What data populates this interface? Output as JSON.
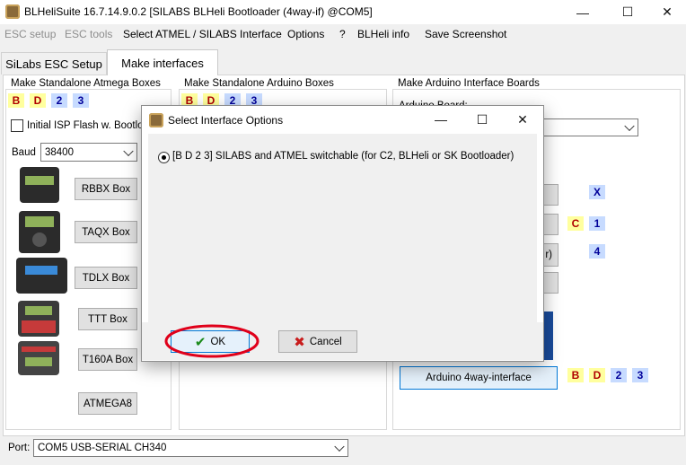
{
  "window": {
    "title": "BLHeliSuite 16.7.14.9.0.2  [SILABS BLHeli Bootloader (4way-if) @COM5]",
    "minimize": "—",
    "maximize": "☐",
    "close": "✕"
  },
  "menu": [
    {
      "label": "ESC setup",
      "enabled": false
    },
    {
      "label": "ESC tools",
      "enabled": false
    },
    {
      "label": "Select ATMEL / SILABS Interface",
      "enabled": true
    },
    {
      "label": "Options",
      "enabled": true
    },
    {
      "label": "?",
      "enabled": true
    },
    {
      "label": "BLHeli info",
      "enabled": true
    },
    {
      "label": "Save Screenshot",
      "enabled": true
    }
  ],
  "tabs": [
    {
      "label": "SiLabs ESC Setup",
      "active": false
    },
    {
      "label": "Make interfaces",
      "active": true
    }
  ],
  "atmega_group": {
    "title": "Make Standalone Atmega Boxes",
    "badges": [
      "B",
      "D",
      "2",
      "3"
    ],
    "initial_isp_label": "Initial ISP Flash w. Bootloa",
    "baud_label": "Baud",
    "baud_value": "38400",
    "buttons": [
      "RBBX Box",
      "TAQX Box",
      "TDLX Box",
      "TTT Box",
      "T160A Box",
      "ATMEGA8"
    ]
  },
  "arduino_boxes_group": {
    "title": "Make Standalone Arduino Boxes",
    "badges": [
      "B",
      "D",
      "2",
      "3"
    ]
  },
  "arduino_boards_group": {
    "title": "Make Arduino Interface Boards",
    "board_label": "Arduino Board:",
    "row_badges": {
      "row1": [
        "X"
      ],
      "row2": [
        "C",
        "1"
      ],
      "row3": [
        "4"
      ]
    },
    "partial_button_text": "r)",
    "fourway_button": "Arduino 4way-interface",
    "fourway_badges": [
      "B",
      "D",
      "2",
      "3"
    ]
  },
  "port": {
    "label": "Port:",
    "value": "COM5    USB-SERIAL CH340"
  },
  "dialog": {
    "title": "Select Interface Options",
    "option_text": "[B D 2 3] SILABS and ATMEL switchable (for C2,  BLHeli or SK Bootloader)",
    "ok_label": "OK",
    "cancel_label": "Cancel",
    "minimize": "—",
    "maximize": "☐",
    "close": "✕"
  },
  "colors": {
    "annotation_circle": "#e0001a",
    "ok_check": "#1a8a1a",
    "cancel_x": "#c81c1c"
  }
}
